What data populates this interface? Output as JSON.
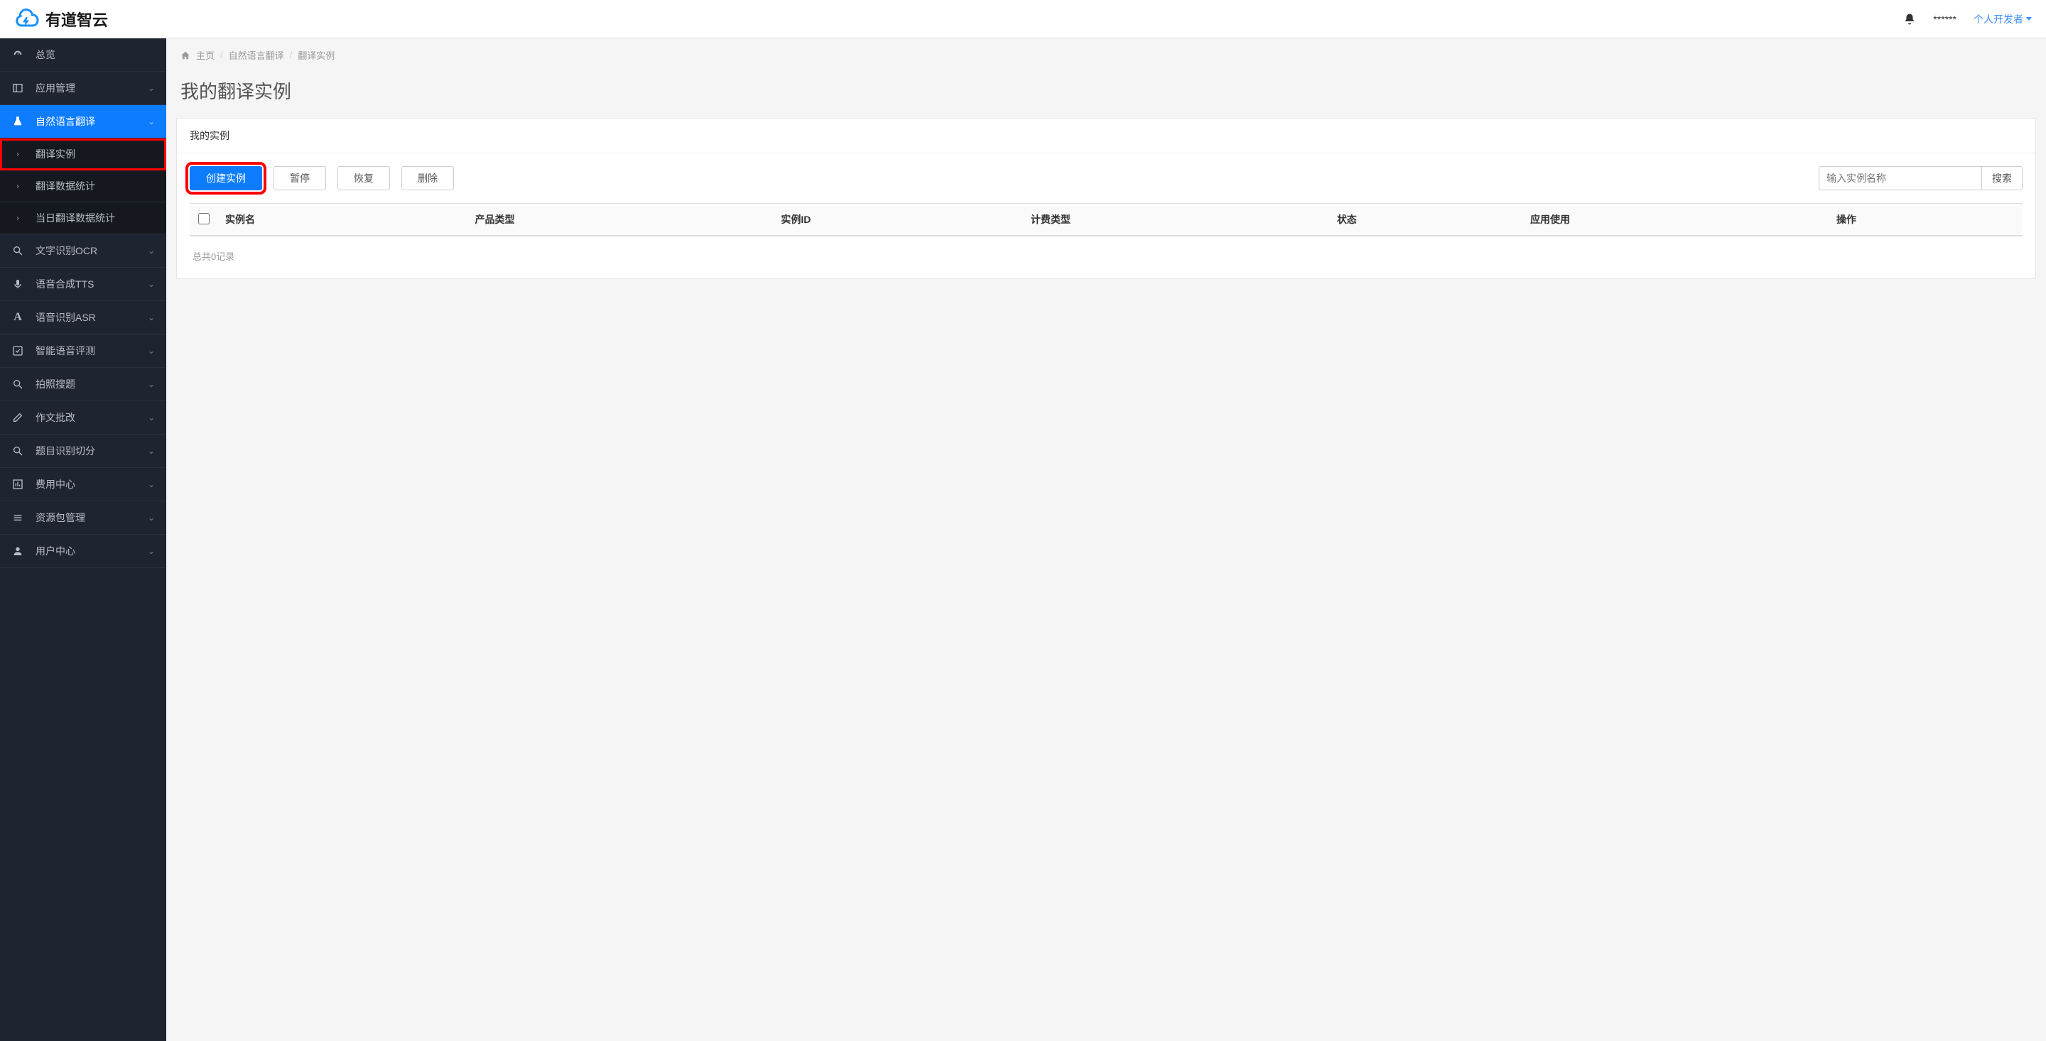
{
  "brand": {
    "text": "有道智云"
  },
  "header": {
    "username": "******",
    "role_label": "个人开发者"
  },
  "sidebar": {
    "items": [
      {
        "id": "overview",
        "label": "总览",
        "icon": "dashboard",
        "active": false,
        "expandable": false
      },
      {
        "id": "app-mgmt",
        "label": "应用管理",
        "icon": "panel",
        "active": false,
        "expandable": true
      },
      {
        "id": "nlp-translate",
        "label": "自然语言翻译",
        "icon": "flask",
        "active": true,
        "expandable": true,
        "children": [
          {
            "id": "translate-instance",
            "label": "翻译实例",
            "highlighted": true
          },
          {
            "id": "translate-stats",
            "label": "翻译数据统计",
            "highlighted": false
          },
          {
            "id": "translate-daily",
            "label": "当日翻译数据统计",
            "highlighted": false
          }
        ]
      },
      {
        "id": "ocr",
        "label": "文字识别OCR",
        "icon": "search",
        "active": false,
        "expandable": true
      },
      {
        "id": "tts",
        "label": "语音合成TTS",
        "icon": "mic",
        "active": false,
        "expandable": true
      },
      {
        "id": "asr",
        "label": "语音识别ASR",
        "icon": "letter-a",
        "active": false,
        "expandable": true
      },
      {
        "id": "voice-eval",
        "label": "智能语音评测",
        "icon": "check-square",
        "active": false,
        "expandable": true
      },
      {
        "id": "photo-search",
        "label": "拍照搜题",
        "icon": "search",
        "active": false,
        "expandable": true
      },
      {
        "id": "essay",
        "label": "作文批改",
        "icon": "edit",
        "active": false,
        "expandable": true
      },
      {
        "id": "question-seg",
        "label": "题目识别切分",
        "icon": "search",
        "active": false,
        "expandable": true
      },
      {
        "id": "billing",
        "label": "费用中心",
        "icon": "chart",
        "active": false,
        "expandable": true
      },
      {
        "id": "resource",
        "label": "资源包管理",
        "icon": "list",
        "active": false,
        "expandable": true
      },
      {
        "id": "user-center",
        "label": "用户中心",
        "icon": "user",
        "active": false,
        "expandable": true
      }
    ]
  },
  "breadcrumb": {
    "home": "主页",
    "section": "自然语言翻译",
    "page": "翻译实例"
  },
  "page": {
    "title": "我的翻译实例"
  },
  "panel": {
    "header": "我的实例",
    "buttons": {
      "create": "创建实例",
      "pause": "暂停",
      "resume": "恢复",
      "delete": "删除",
      "search": "搜索"
    },
    "search_placeholder": "输入实例名称",
    "columns": [
      "实例名",
      "产品类型",
      "实例ID",
      "计费类型",
      "状态",
      "应用使用",
      "操作"
    ],
    "record_summary": "总共0记录"
  }
}
